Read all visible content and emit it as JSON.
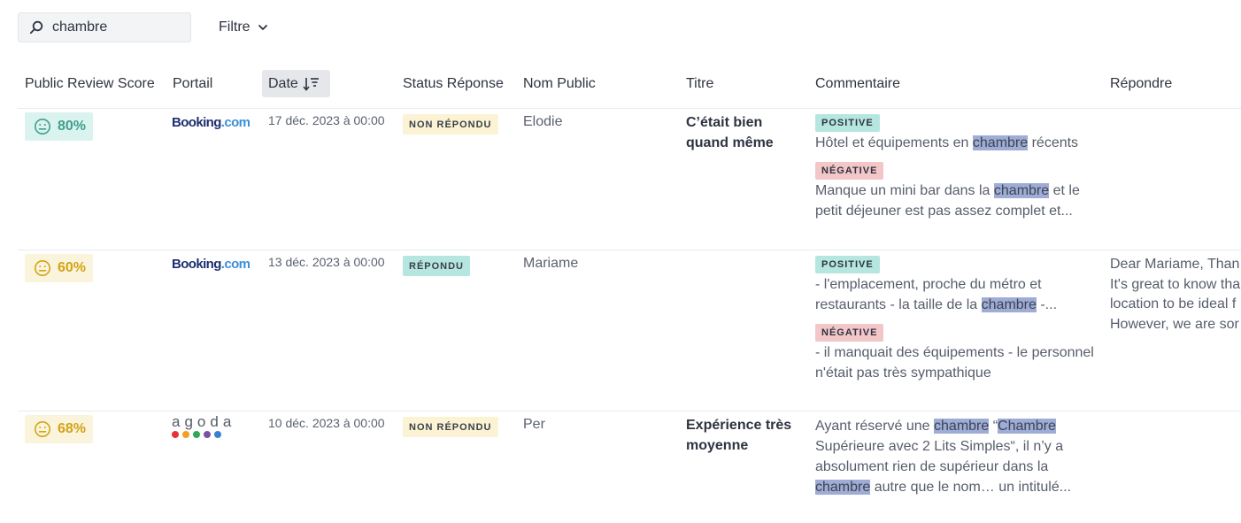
{
  "search": {
    "value": "chambre",
    "icon": "search-icon"
  },
  "filter": {
    "label": "Filtre",
    "icon": "chevron-down-icon"
  },
  "columns": {
    "score": "Public Review Score",
    "portal": "Portail",
    "date": "Date",
    "status": "Status Réponse",
    "name": "Nom Public",
    "title": "Titre",
    "comment": "Commentaire",
    "reply": "Répondre"
  },
  "colors": {
    "score_green": "#3fa08d",
    "score_yellow": "#d3a316",
    "highlight": "#9eacd6",
    "tag_positive": "#b6e6e0",
    "tag_negative": "#f3c6c8"
  },
  "rows": [
    {
      "score": "80%",
      "score_icon": "neutral-face-icon",
      "portal": {
        "part1": "Booking",
        "part2": ".com"
      },
      "date": "17 déc. 2023 à 00:00",
      "status": "NON RÉPONDU",
      "name": "Elodie",
      "title": "C’était bien quand même",
      "positive_tag": "POSITIVE",
      "positive": {
        "a": "Hôtel et équipements en ",
        "h1": "chambre",
        "b": " récents"
      },
      "negative_tag": "NÉGATIVE",
      "negative": {
        "a": "Manque un mini bar dans la ",
        "h1": "chambre",
        "b": " et le petit déjeuner est pas assez complet et..."
      }
    },
    {
      "score": "60%",
      "score_icon": "neutral-face-icon",
      "portal": {
        "part1": "Booking",
        "part2": ".com"
      },
      "date": "13 déc. 2023 à 00:00",
      "status": "RÉPONDU",
      "name": "Mariame",
      "title": "",
      "positive_tag": "POSITIVE",
      "positive": {
        "a": "- l'emplacement, proche du métro et restaurants - la taille de la ",
        "h1": "chambre",
        "b": " -..."
      },
      "negative_tag": "NÉGATIVE",
      "negative": {
        "a": "- il manquait des équipements - le personnel n'était pas très sympathique"
      },
      "reply": [
        "Dear Mariame, Than",
        "It's great to know tha",
        "location to be ideal f",
        "However, we are sor"
      ]
    },
    {
      "score": "68%",
      "score_icon": "neutral-face-icon",
      "portal": {
        "name": "agoda"
      },
      "date": "10 déc. 2023 à 00:00",
      "status": "NON RÉPONDU",
      "name": "Per",
      "title": "Expérience très moyenne",
      "comment": {
        "a": "Ayant réservé une ",
        "h1": "chambre",
        "b": " “",
        "h2": "Chambre",
        "c": " Supérieure avec 2 Lits Simples“, il n’y a absolument rien de supérieur dans la ",
        "h3": "chambre",
        "d": " autre que le nom… un intitulé..."
      }
    }
  ]
}
